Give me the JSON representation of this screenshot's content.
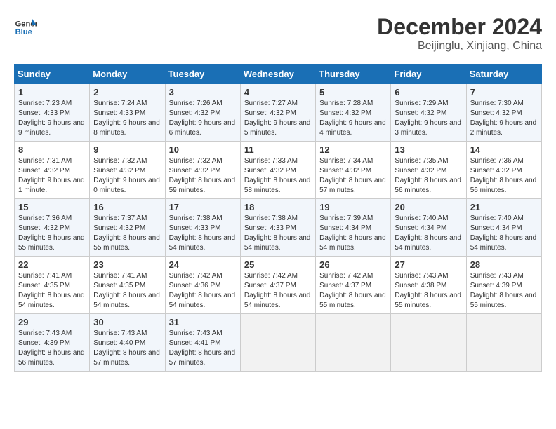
{
  "header": {
    "logo_line1": "General",
    "logo_line2": "Blue",
    "month": "December 2024",
    "location": "Beijinglu, Xinjiang, China"
  },
  "weekdays": [
    "Sunday",
    "Monday",
    "Tuesday",
    "Wednesday",
    "Thursday",
    "Friday",
    "Saturday"
  ],
  "weeks": [
    [
      {
        "day": 1,
        "sunrise": "7:23 AM",
        "sunset": "4:33 PM",
        "daylight": "9 hours and 9 minutes."
      },
      {
        "day": 2,
        "sunrise": "7:24 AM",
        "sunset": "4:33 PM",
        "daylight": "9 hours and 8 minutes."
      },
      {
        "day": 3,
        "sunrise": "7:26 AM",
        "sunset": "4:32 PM",
        "daylight": "9 hours and 6 minutes."
      },
      {
        "day": 4,
        "sunrise": "7:27 AM",
        "sunset": "4:32 PM",
        "daylight": "9 hours and 5 minutes."
      },
      {
        "day": 5,
        "sunrise": "7:28 AM",
        "sunset": "4:32 PM",
        "daylight": "9 hours and 4 minutes."
      },
      {
        "day": 6,
        "sunrise": "7:29 AM",
        "sunset": "4:32 PM",
        "daylight": "9 hours and 3 minutes."
      },
      {
        "day": 7,
        "sunrise": "7:30 AM",
        "sunset": "4:32 PM",
        "daylight": "9 hours and 2 minutes."
      }
    ],
    [
      {
        "day": 8,
        "sunrise": "7:31 AM",
        "sunset": "4:32 PM",
        "daylight": "9 hours and 1 minute."
      },
      {
        "day": 9,
        "sunrise": "7:32 AM",
        "sunset": "4:32 PM",
        "daylight": "9 hours and 0 minutes."
      },
      {
        "day": 10,
        "sunrise": "7:32 AM",
        "sunset": "4:32 PM",
        "daylight": "8 hours and 59 minutes."
      },
      {
        "day": 11,
        "sunrise": "7:33 AM",
        "sunset": "4:32 PM",
        "daylight": "8 hours and 58 minutes."
      },
      {
        "day": 12,
        "sunrise": "7:34 AM",
        "sunset": "4:32 PM",
        "daylight": "8 hours and 57 minutes."
      },
      {
        "day": 13,
        "sunrise": "7:35 AM",
        "sunset": "4:32 PM",
        "daylight": "8 hours and 56 minutes."
      },
      {
        "day": 14,
        "sunrise": "7:36 AM",
        "sunset": "4:32 PM",
        "daylight": "8 hours and 56 minutes."
      }
    ],
    [
      {
        "day": 15,
        "sunrise": "7:36 AM",
        "sunset": "4:32 PM",
        "daylight": "8 hours and 55 minutes."
      },
      {
        "day": 16,
        "sunrise": "7:37 AM",
        "sunset": "4:32 PM",
        "daylight": "8 hours and 55 minutes."
      },
      {
        "day": 17,
        "sunrise": "7:38 AM",
        "sunset": "4:33 PM",
        "daylight": "8 hours and 54 minutes."
      },
      {
        "day": 18,
        "sunrise": "7:38 AM",
        "sunset": "4:33 PM",
        "daylight": "8 hours and 54 minutes."
      },
      {
        "day": 19,
        "sunrise": "7:39 AM",
        "sunset": "4:34 PM",
        "daylight": "8 hours and 54 minutes."
      },
      {
        "day": 20,
        "sunrise": "7:40 AM",
        "sunset": "4:34 PM",
        "daylight": "8 hours and 54 minutes."
      },
      {
        "day": 21,
        "sunrise": "7:40 AM",
        "sunset": "4:34 PM",
        "daylight": "8 hours and 54 minutes."
      }
    ],
    [
      {
        "day": 22,
        "sunrise": "7:41 AM",
        "sunset": "4:35 PM",
        "daylight": "8 hours and 54 minutes."
      },
      {
        "day": 23,
        "sunrise": "7:41 AM",
        "sunset": "4:35 PM",
        "daylight": "8 hours and 54 minutes."
      },
      {
        "day": 24,
        "sunrise": "7:42 AM",
        "sunset": "4:36 PM",
        "daylight": "8 hours and 54 minutes."
      },
      {
        "day": 25,
        "sunrise": "7:42 AM",
        "sunset": "4:37 PM",
        "daylight": "8 hours and 54 minutes."
      },
      {
        "day": 26,
        "sunrise": "7:42 AM",
        "sunset": "4:37 PM",
        "daylight": "8 hours and 55 minutes."
      },
      {
        "day": 27,
        "sunrise": "7:43 AM",
        "sunset": "4:38 PM",
        "daylight": "8 hours and 55 minutes."
      },
      {
        "day": 28,
        "sunrise": "7:43 AM",
        "sunset": "4:39 PM",
        "daylight": "8 hours and 55 minutes."
      }
    ],
    [
      {
        "day": 29,
        "sunrise": "7:43 AM",
        "sunset": "4:39 PM",
        "daylight": "8 hours and 56 minutes."
      },
      {
        "day": 30,
        "sunrise": "7:43 AM",
        "sunset": "4:40 PM",
        "daylight": "8 hours and 57 minutes."
      },
      {
        "day": 31,
        "sunrise": "7:43 AM",
        "sunset": "4:41 PM",
        "daylight": "8 hours and 57 minutes."
      },
      null,
      null,
      null,
      null
    ]
  ]
}
